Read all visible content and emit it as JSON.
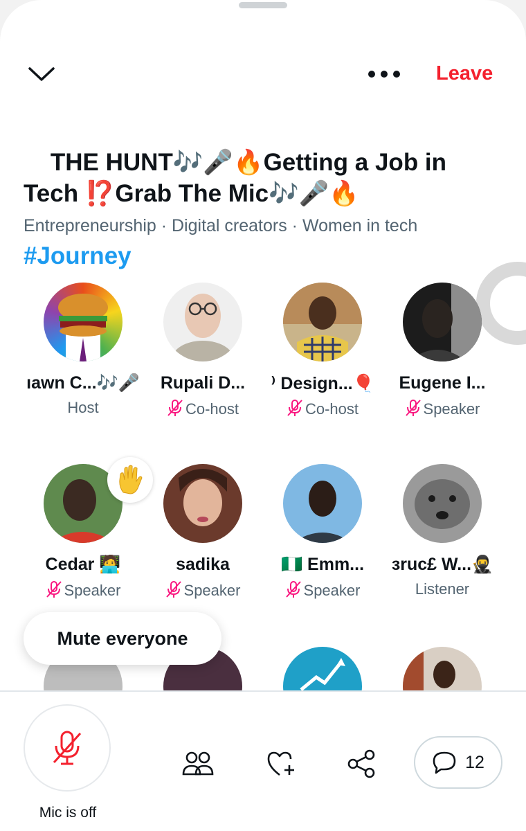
{
  "header": {
    "leave_label": "Leave"
  },
  "space": {
    "title": "THE HUNT🎶🎤🔥Getting a Job in\nTech ⁉️Grab The Mic🎶🎤🔥",
    "hashtag": "#Journey",
    "topics": "Entrepreneurship · Digital creators · Women in tech"
  },
  "participants": [
    {
      "name": "ıawn C...🎶🎤",
      "role": "Host",
      "muted": false
    },
    {
      "name": "Rupali D...",
      "role": "Co-host",
      "muted": true
    },
    {
      "name": "⁾ Design...🎈",
      "role": "Co-host",
      "muted": true
    },
    {
      "name": "Eugene I...",
      "role": "Speaker",
      "muted": true
    },
    {
      "name": "Cedar 🧑‍💻",
      "role": "Speaker",
      "muted": true,
      "hand_raised": true
    },
    {
      "name": "sadika",
      "role": "Speaker",
      "muted": true
    },
    {
      "name": "🇳🇬 Emm...",
      "role": "Speaker",
      "muted": true
    },
    {
      "name": "ɜruc£ W...🥷",
      "role": "Listener",
      "muted": false
    }
  ],
  "mute_everyone_label": "Mute everyone",
  "bottom": {
    "mic_label": "Mic is off",
    "comments_count": "12"
  },
  "colors": {
    "leave": "#f4212e",
    "hashtag": "#1d9bf0",
    "mic_off": "#f91880",
    "secondary_text": "#536471"
  },
  "icons": [
    "chevron-down-icon",
    "more-icon",
    "hand-raise-icon",
    "mic-off-icon",
    "people-icon",
    "heart-plus-icon",
    "share-icon",
    "comment-icon"
  ]
}
